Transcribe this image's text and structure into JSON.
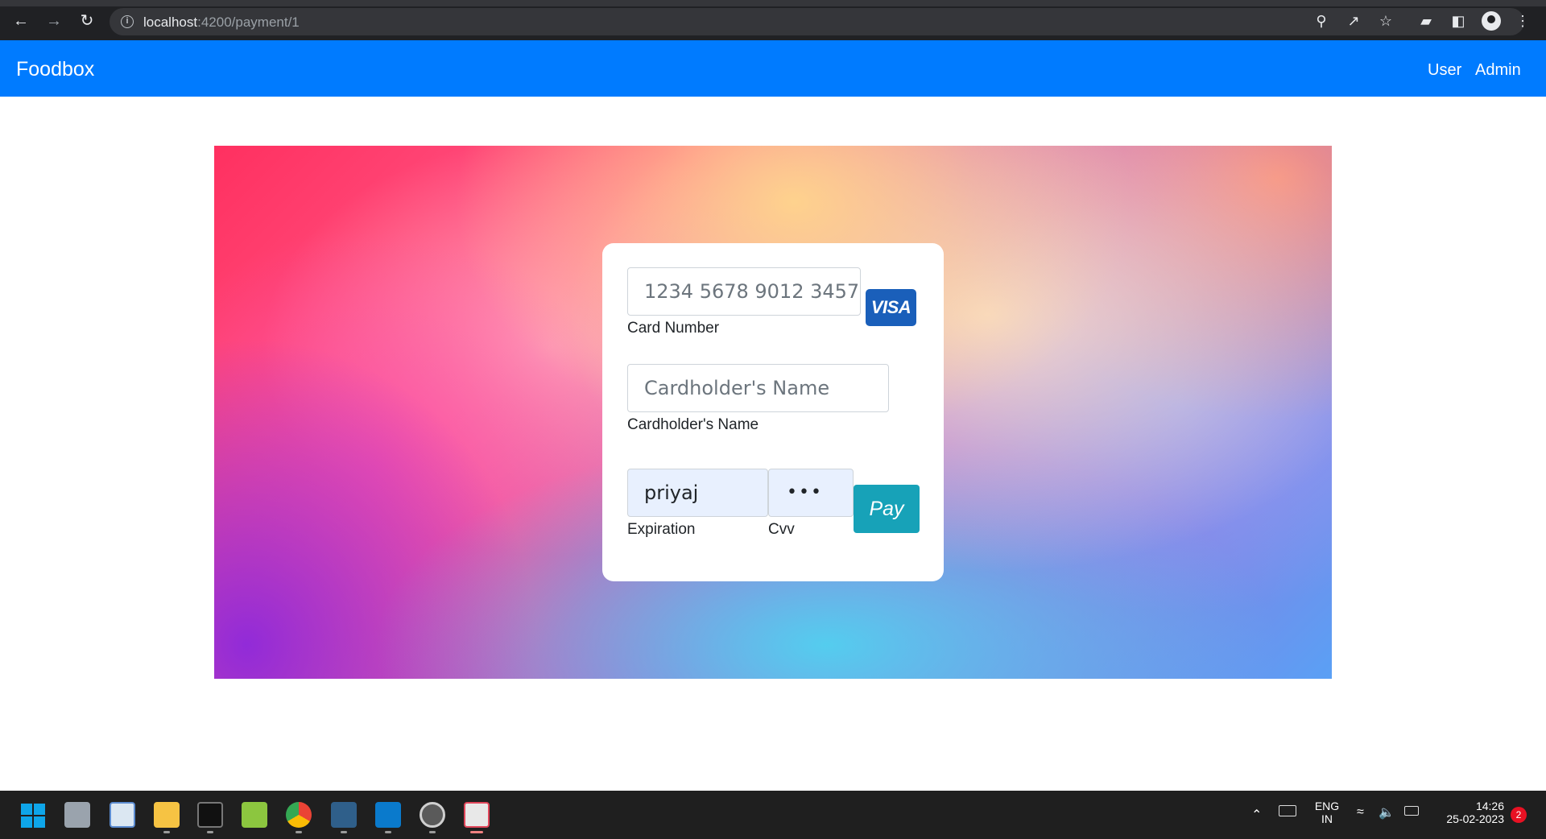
{
  "browser": {
    "url_host": "localhost",
    "url_path": ":4200/payment/1",
    "icons": [
      "back-icon",
      "forward-icon",
      "reload-icon",
      "info-icon",
      "key-icon",
      "share-icon",
      "star-icon",
      "extensions-icon",
      "side-panel-icon",
      "profile-icon",
      "menu-icon"
    ]
  },
  "navbar": {
    "brand": "Foodbox",
    "links": [
      "User",
      "Admin"
    ],
    "color": "#007bff"
  },
  "payment": {
    "card_number_placeholder": "1234 5678 9012 3457",
    "card_number_label": "Card Number",
    "card_brand": "VISA",
    "name_placeholder": "Cardholder's Name",
    "name_label": "Cardholder's Name",
    "expiration_value": "priyaj",
    "expiration_label": "Expiration",
    "cvv_value": "•••",
    "cvv_label": "Cvv",
    "pay_label": "Pay",
    "pay_color": "#17a2b8"
  },
  "taskbar": {
    "apps": [
      "start-icon",
      "task-view-icon",
      "monitor-app-icon",
      "file-explorer-icon",
      "terminal-icon",
      "notepad-plus-icon",
      "chrome-icon",
      "mysql-workbench-icon",
      "vscode-icon",
      "settings-app-icon",
      "snipping-tool-icon"
    ],
    "lang_line1": "ENG",
    "lang_line2": "IN",
    "time": "14:26",
    "date": "25-02-2023",
    "notification_count": "2"
  }
}
